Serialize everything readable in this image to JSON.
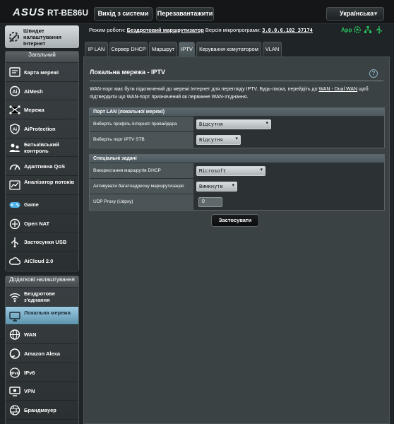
{
  "brand": {
    "logo": "ASUS",
    "model": "RT-BE86U"
  },
  "topbar": {
    "logout_label": "Вихід з системи",
    "reboot_label": "Перезавантажити",
    "language": "Українська"
  },
  "status": {
    "mode_label": "Режим роботи:",
    "mode_value": "Бездротовий маршрутизатор",
    "firmware_label": "Версія мікропрограми:",
    "firmware_value": "3.0.0.6.102_37174",
    "app_label": "App"
  },
  "sidebar": {
    "qis_label": "Швидке налаштування Інтернет",
    "general_header": "Загальний",
    "general_items": [
      {
        "label": "Карта мережі",
        "icon": "network-map-icon"
      },
      {
        "label": "AiMesh",
        "icon": "aimesh-icon"
      },
      {
        "label": "Мережа",
        "icon": "network-icon"
      },
      {
        "label": "AiProtection",
        "icon": "shield-icon"
      },
      {
        "label": "Батьківський контроль",
        "icon": "parental-control-icon"
      },
      {
        "label": "Адаптивна QoS",
        "icon": "qos-icon"
      },
      {
        "label": "Аналізатор потоків",
        "icon": "traffic-analyzer-icon"
      },
      {
        "label": "Game",
        "icon": "gamepad-icon"
      },
      {
        "label": "Open NAT",
        "icon": "open-nat-icon"
      },
      {
        "label": "Застосунки USB",
        "icon": "usb-icon"
      },
      {
        "label": "AiCloud 2.0",
        "icon": "cloud-icon"
      }
    ],
    "advanced_header": "Додаткові налаштування",
    "advanced_items": [
      {
        "label": "Бездротове з'єднання",
        "icon": "wireless-icon"
      },
      {
        "label": "Локальна мережа",
        "icon": "lan-icon",
        "active": true
      },
      {
        "label": "WAN",
        "icon": "globe-icon"
      },
      {
        "label": "Amazon Alexa",
        "icon": "alexa-icon"
      },
      {
        "label": "IPv6",
        "icon": "ipv6-icon"
      },
      {
        "label": "VPN",
        "icon": "vpn-icon"
      },
      {
        "label": "Брандмауер",
        "icon": "firewall-icon"
      }
    ]
  },
  "tabs": [
    "IP LAN",
    "Сервер DHCP",
    "Маршрут",
    "IPTV",
    "Керування комутатором",
    "VLAN"
  ],
  "active_tab": "IPTV",
  "page": {
    "title": "Локальна мережа - IPTV",
    "help_label": "?",
    "description_1": "WAN-порт має бути підключений до мережі Інтернет для перегляду IPTV. Будь-ласка, перейдіть до ",
    "description_link": "WAN - Dual WAN",
    "description_2": " щоб підтвердити що WAN-порт призначений як первинне WAN-з'єднання.",
    "section1": {
      "header": "Порт LAN (локальної мережі)",
      "rows": [
        {
          "label": "Виберіть профіль Інтернет-провайдера",
          "value": "Відсутня"
        },
        {
          "label": "Виберіть порт IPTV STB",
          "value": "Відсутня"
        }
      ]
    },
    "section2": {
      "header": "Спеціальні задачі",
      "rows": [
        {
          "label": "Використання маршрутів DHCP",
          "value": "Microsoft"
        },
        {
          "label": "Активувати багатоадресну маршрутизацію",
          "value": "Вимкнути"
        },
        {
          "label": "UDP Proxy (Udpxy)",
          "value": "0"
        }
      ]
    },
    "apply_label": "Застосувати"
  },
  "colors": {
    "accent_active": "#7fb4cd",
    "app_green": "#2ac15d",
    "panel": "#3a4244"
  }
}
